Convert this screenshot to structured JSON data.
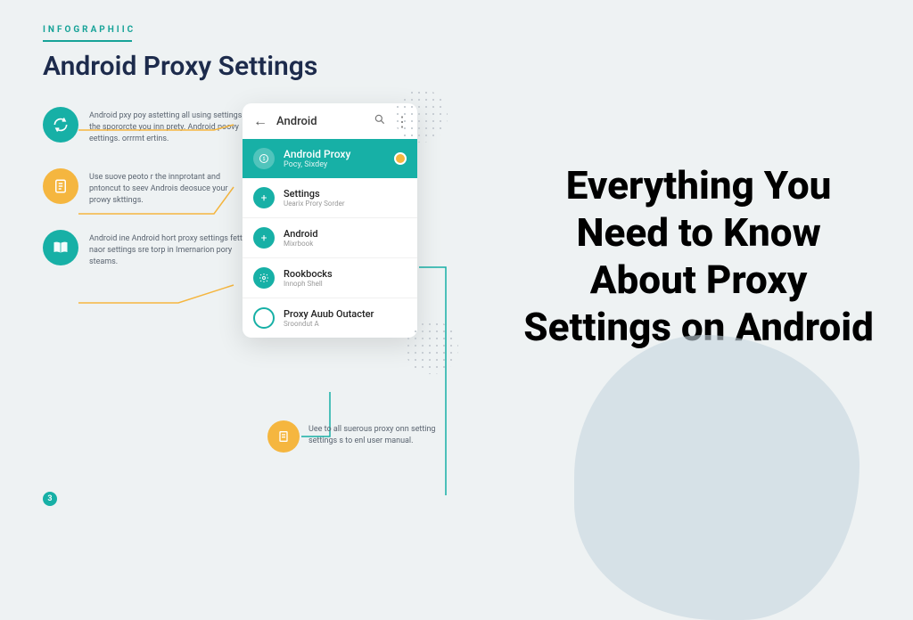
{
  "eyebrow": "INFOGRAPHIIC",
  "main_title": "Android Proxy Settings",
  "info_blocks": [
    {
      "text": "Android pxy poy astetting all using settings the spororcte you inn prety. Android poovy eettings. orrrmt ertins."
    },
    {
      "text": "Use suove peoto r the innprotant and pntoncut to seev Androis deosuce your prowy skttings."
    },
    {
      "text": "Android ine Android hort proxy settings fett x naor settings sre torp in Imernarion pory steams."
    }
  ],
  "phone": {
    "header_title": "Android",
    "active": {
      "title": "Android Proxy",
      "sub": "Pocy, Sixdey"
    },
    "rows": [
      {
        "title": "Settings",
        "sub": "Uearix Prory Sorder"
      },
      {
        "title": "Android",
        "sub": "Mixrbook"
      },
      {
        "title": "Rookbocks",
        "sub": "Innoph Shell"
      },
      {
        "title": "Proxy Auub Outacter",
        "sub": "Sroondut A"
      }
    ]
  },
  "bottom_info": {
    "text": "Uee to all suerous proxy onn setting settings s to enl user manual."
  },
  "page_number": "3",
  "headline": "Everything You Need to Know About Proxy Settings on Android"
}
